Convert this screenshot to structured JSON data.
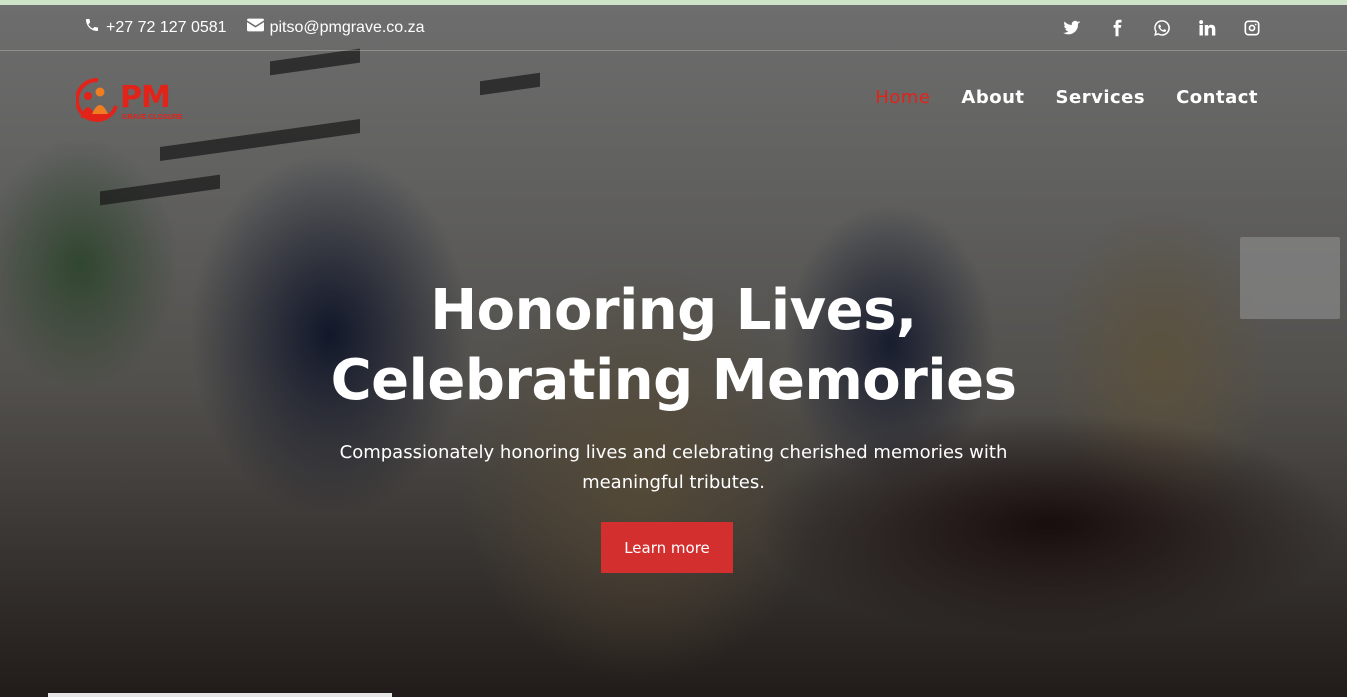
{
  "topbar": {
    "phone": "+27 72 127 0581",
    "email": "pitso@pmgrave.co.za",
    "phone_icon": "phone-icon",
    "email_icon": "envelope-icon",
    "social": [
      "twitter-icon",
      "facebook-icon",
      "whatsapp-icon",
      "linkedin-icon",
      "instagram-icon"
    ]
  },
  "brand": {
    "name": "PM",
    "tagline": "GRAVE CLOSURE",
    "color": "#e2231a"
  },
  "nav": {
    "items": [
      {
        "label": "Home",
        "active": true
      },
      {
        "label": "About",
        "active": false
      },
      {
        "label": "Services",
        "active": false
      },
      {
        "label": "Contact",
        "active": false
      }
    ],
    "active_color": "#e2231a"
  },
  "hero": {
    "title_line1": "Honoring Lives,",
    "title_line2": "Celebrating Memories",
    "subtitle_line1": "Compassionately honoring lives and celebrating cherished memories with",
    "subtitle_line2": "meaningful tributes.",
    "cta_label": "Learn more",
    "cta_color": "#d32f2f"
  }
}
